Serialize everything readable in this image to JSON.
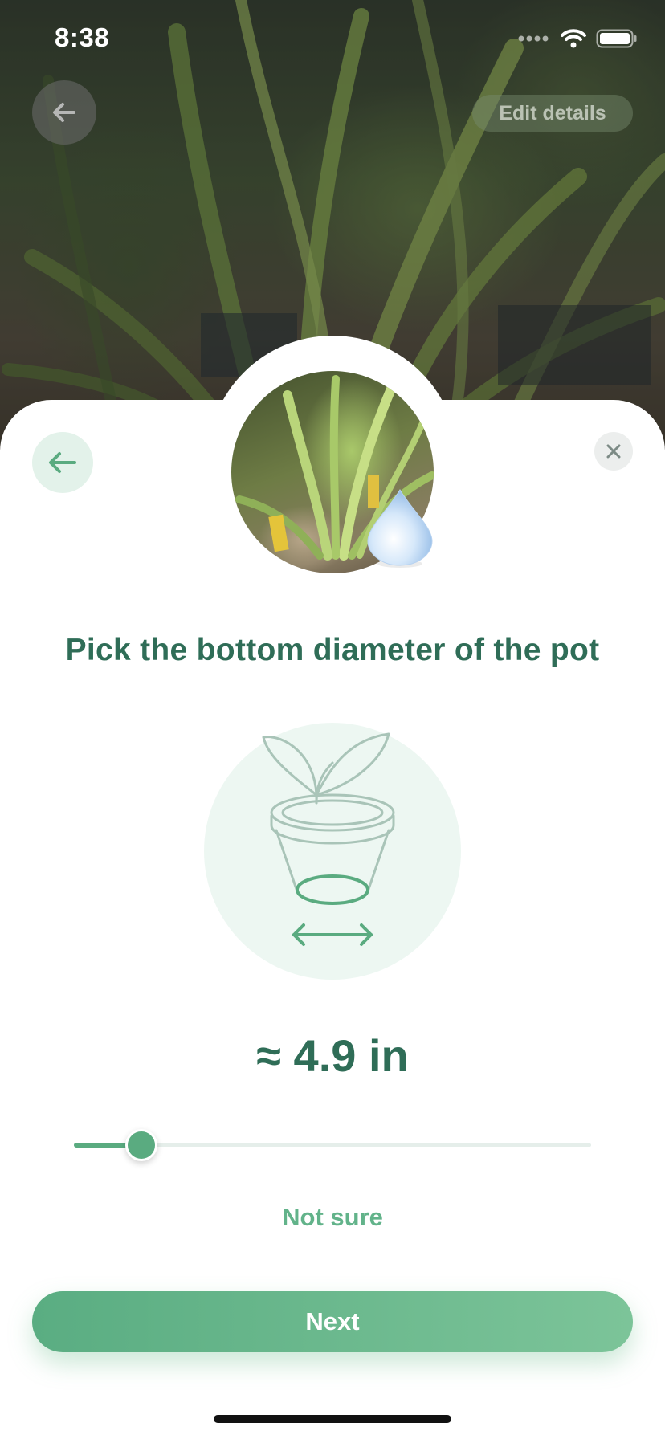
{
  "status_bar": {
    "time": "8:38",
    "icons": [
      "signal-icon",
      "wifi-icon",
      "battery-icon"
    ]
  },
  "photo_header": {
    "back_icon": "arrow-left-icon",
    "edit_details_label": "Edit details"
  },
  "sheet": {
    "back_icon": "arrow-left-icon",
    "close_icon": "close-icon",
    "plant_thumbnail": "plant-photo",
    "badge_icon": "water-drop-icon",
    "question": "Pick the bottom diameter of the pot",
    "illustration_icon": "pot-diameter-icon",
    "value_display": "≈ 4.9 in",
    "slider": {
      "value_fraction": 0.13
    },
    "not_sure_label": "Not sure",
    "next_label": "Next"
  },
  "colors": {
    "primary_green": "#5aab80",
    "title_green": "#2f6d57",
    "light_green_bg": "#edf7f2"
  }
}
